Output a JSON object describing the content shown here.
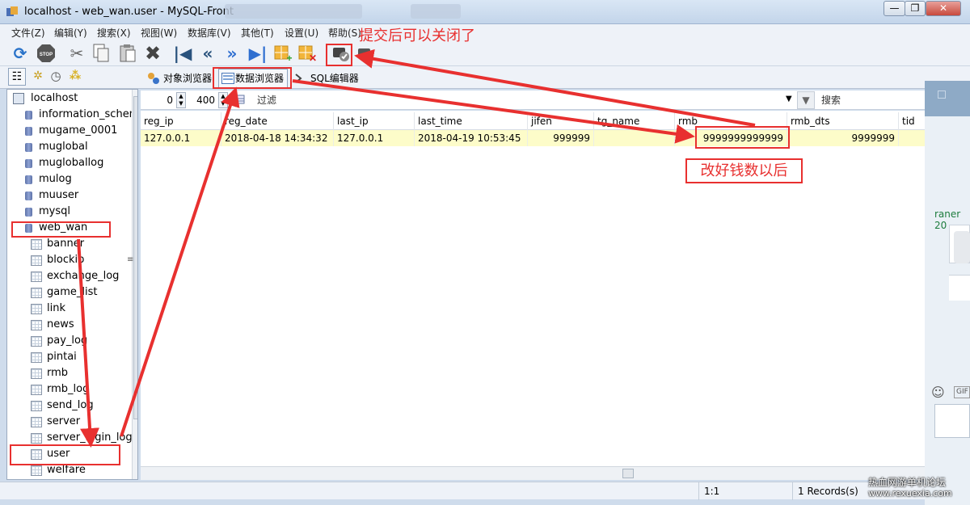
{
  "window": {
    "title": "localhost - web_wan.user - MySQL-Front",
    "minimize_label": "—",
    "restore_label": "❐",
    "close_label": "✕"
  },
  "menu": [
    "文件(Z)",
    "编辑(Y)",
    "搜索(X)",
    "视图(W)",
    "数据库(V)",
    "其他(T)",
    "设置(U)",
    "帮助(S)"
  ],
  "toolbar_icons": [
    "refresh-icon",
    "stop-icon",
    "cut-icon",
    "copy-icon",
    "paste-icon",
    "delete-icon",
    "first-record-icon",
    "prev-page-icon",
    "next-page-icon",
    "last-record-icon",
    "insert-record-icon",
    "delete-record-icon",
    "post-icon",
    "cancel-icon"
  ],
  "view_tabs": {
    "object_browser": "对象浏览器",
    "data_browser": "数据浏览器",
    "sql_editor": "SQL编辑器"
  },
  "tree": {
    "host": "localhost",
    "databases": [
      "information_schem",
      "mugame_0001",
      "muglobal",
      "mugloballog",
      "mulog",
      "muuser",
      "mysql",
      "web_wan"
    ],
    "tables": [
      "banner",
      "blockip",
      "exchange_log",
      "game_list",
      "link",
      "news",
      "pay_log",
      "pintai",
      "rmb",
      "rmb_log",
      "send_log",
      "server",
      "server_login_log",
      "user",
      "welfare"
    ]
  },
  "filter": {
    "offset": "0",
    "limit": "400",
    "filter_placeholder": "过滤",
    "search_placeholder": "搜索"
  },
  "grid": {
    "columns": [
      "reg_ip",
      "reg_date",
      "last_ip",
      "last_time",
      "jifen",
      "tg_name",
      "rmb",
      "rmb_dts",
      "tid"
    ],
    "rows": [
      [
        "127.0.0.1",
        "2018-04-18 14:34:32",
        "127.0.0.1",
        "2018-04-19 10:53:45",
        "999999",
        "",
        "9999999999999",
        "9999999",
        ""
      ]
    ]
  },
  "status": {
    "position": "1:1",
    "records": "1 Records(s)"
  },
  "annotations": {
    "submit_note": "提交后可以关闭了",
    "money_note": "改好钱数以后"
  },
  "chat_panel": {
    "name": "raner 20",
    "gif_label": "GIF"
  },
  "watermark": {
    "line1": "热血网游单机论坛",
    "line2": "www.rexuexia.com"
  },
  "colors": {
    "annotation_red": "#e8302f",
    "selected_row": "#fdfcc9"
  }
}
